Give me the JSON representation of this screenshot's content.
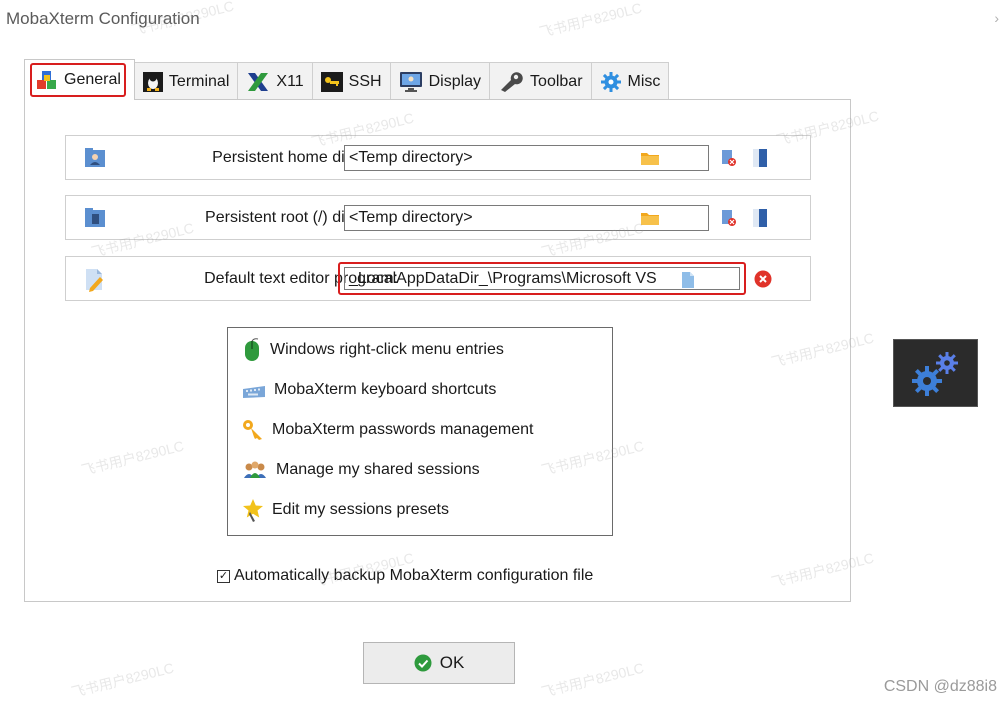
{
  "window": {
    "title": "MobaXterm Configuration",
    "close_glyph": "›"
  },
  "tabs": [
    {
      "label": "General",
      "icon": "cubes-icon",
      "active": true
    },
    {
      "label": "Terminal",
      "icon": "linux-penguin-icon",
      "active": false
    },
    {
      "label": "X11",
      "icon": "x11-icon",
      "active": false
    },
    {
      "label": "SSH",
      "icon": "ssh-key-icon",
      "active": false
    },
    {
      "label": "Display",
      "icon": "monitor-icon",
      "active": false
    },
    {
      "label": "Toolbar",
      "icon": "wrench-icon",
      "active": false
    },
    {
      "label": "Misc",
      "icon": "gear-icon",
      "active": false
    }
  ],
  "settings": {
    "home_dir": {
      "label": "Persistent home directory:",
      "value": "<Temp directory>"
    },
    "root_dir": {
      "label": "Persistent root (/) directory:",
      "value": "<Temp directory>"
    },
    "editor": {
      "label": "Default text editor program:",
      "value": "_LocalAppDataDir_\\Programs\\Microsoft VS"
    }
  },
  "menu": [
    {
      "label": "Windows right-click menu entries",
      "icon": "mouse-icon"
    },
    {
      "label": "MobaXterm keyboard shortcuts",
      "icon": "keyboard-icon"
    },
    {
      "label": "MobaXterm passwords management",
      "icon": "key-icon"
    },
    {
      "label": "Manage my shared sessions",
      "icon": "users-icon"
    },
    {
      "label": "Edit my sessions presets",
      "icon": "star-pen-icon"
    }
  ],
  "backup": {
    "label": "Automatically backup MobaXterm configuration file",
    "checked": true,
    "check_glyph": "✓"
  },
  "ok_button": {
    "label": "OK"
  },
  "watermark": {
    "text": "飞书用户8290LC"
  },
  "csdn": {
    "text": "CSDN @dz88i8"
  },
  "colors": {
    "highlight": "#d81e1e",
    "ok_green": "#2e9a3d",
    "folder": "#f2a81d",
    "badge_bg": "#2b2b2b",
    "gear_blue": "#3d7fd8"
  }
}
